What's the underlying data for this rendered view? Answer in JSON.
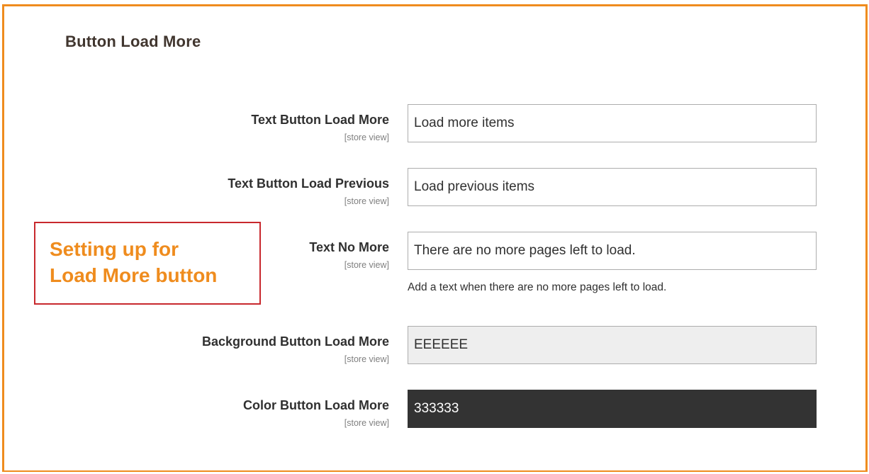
{
  "section": {
    "title": "Button Load More"
  },
  "fields": [
    {
      "label": "Text Button Load More",
      "scope": "[store view]",
      "value": "Load more items"
    },
    {
      "label": "Text Button Load Previous",
      "scope": "[store view]",
      "value": "Load previous items"
    },
    {
      "label": "Text No More",
      "scope": "[store view]",
      "value": "There are no more pages left to load.",
      "note": "Add a text when there are no more pages left to load."
    },
    {
      "label": "Background Button Load More",
      "scope": "[store view]",
      "value": "EEEEEE"
    },
    {
      "label": "Color Button Load More",
      "scope": "[store view]",
      "value": "333333"
    }
  ],
  "callout": {
    "line1": "Setting up for",
    "line2": "Load More button"
  },
  "colors": {
    "frame": "#ef8c1e",
    "callout_border": "#c8282d",
    "callout_text": "#ef8c1e",
    "bg_swatch": "#EEEEEE",
    "color_swatch": "#333333"
  }
}
